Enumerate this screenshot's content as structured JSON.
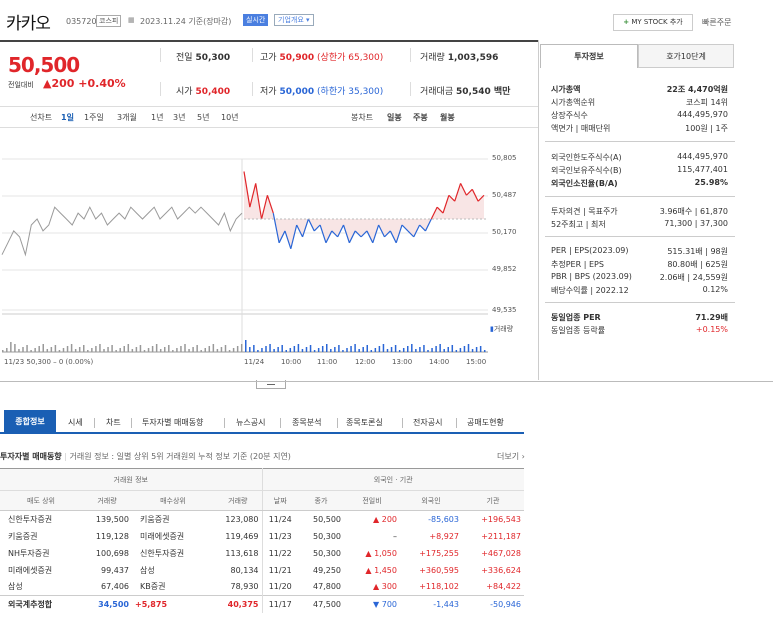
{
  "header": {
    "stock_name": "카카오",
    "stock_code": "035720",
    "market": "코스피",
    "date": "2023.11.24 기준(장마감)",
    "live_badge": "실시간",
    "company_info": "기업개요",
    "my_stock": "MY STOCK 추가",
    "quick_order": "빠른주문"
  },
  "price": {
    "current": "50,500",
    "change_label": "전일대비",
    "change": "▲200",
    "change_pct": "+0.40%"
  },
  "quote": {
    "prev_label": "전일",
    "prev": "50,300",
    "high_label": "고가",
    "high": "50,900",
    "high_limit": "(상한가 65,300)",
    "volume_label": "거래량",
    "volume": "1,003,596",
    "open_label": "시가",
    "open": "50,400",
    "low_label": "저가",
    "low": "50,000",
    "low_limit": "(하한가 35,300)",
    "amount_label": "거래대금",
    "amount": "50,540 백만"
  },
  "periods": {
    "items": [
      "선차트",
      "1일",
      "1주일",
      "3개월",
      "1년",
      "3년",
      "5년",
      "10년"
    ],
    "candle": [
      "봉차트",
      "일봉",
      "주봉",
      "월봉"
    ]
  },
  "chart_data": {
    "type": "line",
    "y_ticks": [
      "50,805",
      "50,487",
      "50,170",
      "49,852",
      "49,535"
    ],
    "ylim": [
      49535,
      50805
    ],
    "reference": 50300,
    "x_ticks": [
      "11/24",
      "10:00",
      "11:00",
      "12:00",
      "13:00",
      "14:00",
      "15:00"
    ],
    "prev_day_label": "11/23  50,300 – 0 (0.00%)",
    "volume_legend": "거래량",
    "series": [
      {
        "values": [
          50000,
          50100,
          50200,
          50150,
          50000,
          50250,
          50300,
          50200,
          50250,
          50400,
          50350,
          50300,
          50250,
          50350,
          50300,
          50400,
          50300,
          50350,
          50250,
          50300,
          50350,
          50300,
          50400,
          50350,
          50300,
          50350,
          50400,
          50300,
          50350,
          50400,
          50300,
          50350,
          50400,
          50350,
          50400,
          50350,
          50300,
          50250,
          50350,
          50200,
          50300,
          50350
        ]
      },
      {
        "values": [
          50700,
          50400,
          50600,
          50300,
          50500,
          50350,
          50100,
          50200,
          50050,
          50250,
          50150,
          50300,
          50200,
          50250,
          50100,
          50200,
          50150,
          50250,
          50100,
          50200,
          50150,
          50200,
          50100,
          50250,
          50150,
          50200,
          50100,
          50250,
          50200,
          50150,
          50250,
          50200,
          50300,
          50400,
          50350,
          50500,
          50450,
          50600,
          50500,
          50550,
          50450,
          50500
        ]
      }
    ]
  },
  "invest_tabs": [
    "투자정보",
    "호가10단계"
  ],
  "invest": [
    {
      "label": "시가총액",
      "value": "22조 4,470억원",
      "bold": true
    },
    {
      "label": "시가총액순위",
      "value": "코스피 14위"
    },
    {
      "label": "상장주식수",
      "value": "444,495,970"
    },
    {
      "label": "액면가 | 매매단위",
      "value": "100원 | 1주"
    },
    {
      "label": "외국인한도주식수(A)",
      "value": "444,495,970"
    },
    {
      "label": "외국인보유주식수(B)",
      "value": "115,477,401"
    },
    {
      "label": "외국인소진율(B/A)",
      "value": "25.98%",
      "bold": true
    },
    {
      "label": "투자의견 | 목표주가",
      "value": "3.96매수 | 61,870"
    },
    {
      "label": "52주최고 | 최저",
      "value": "71,300 | 37,300"
    },
    {
      "label": "PER | EPS(2023.09)",
      "value": "515.31배 | 98원"
    },
    {
      "label": "추정PER | EPS",
      "value": "80.80배 | 625원"
    },
    {
      "label": "PBR | BPS (2023.09)",
      "value": "2.06배 | 24,559원"
    },
    {
      "label": "배당수익률 | 2022.12",
      "value": "0.12%"
    },
    {
      "label": "동일업종 PER",
      "value": "71.29배",
      "bold": true
    },
    {
      "label": "동일업종 등락률",
      "value": "+0.15%"
    }
  ],
  "nav_tabs": [
    "종합정보",
    "시세",
    "차트",
    "투자자별 매매동향",
    "뉴스공시",
    "종목분석",
    "종목토론실",
    "전자공시",
    "공매도현황"
  ],
  "trade_section": {
    "title": "투자자별 매매동향",
    "desc": "거래원 정보 : 일별 상위 5위 거래원의 누적 정보 기준 (20분 지연)",
    "more": "더보기",
    "group1": "거래원 정보",
    "group2": "외국인 · 기관",
    "headers": [
      "매도 상위",
      "거래량",
      "매수상위",
      "거래량",
      "날짜",
      "종가",
      "전일비",
      "외국인",
      "기관"
    ]
  },
  "trade_rows": [
    {
      "sell": "신한투자증권",
      "sv": "139,500",
      "buy": "키움증권",
      "bv": "123,080",
      "date": "11/24",
      "close": "50,500",
      "diff": "▲ 200",
      "dir": "up",
      "foreign": "-85,603",
      "inst": "+196,543"
    },
    {
      "sell": "키움증권",
      "sv": "119,128",
      "buy": "미래에셋증권",
      "bv": "119,469",
      "date": "11/23",
      "close": "50,300",
      "diff": "–",
      "dir": "none",
      "foreign": "+8,927",
      "inst": "+211,187"
    },
    {
      "sell": "NH투자증권",
      "sv": "100,698",
      "buy": "신한투자증권",
      "bv": "113,618",
      "date": "11/22",
      "close": "50,300",
      "diff": "▲ 1,050",
      "dir": "up",
      "foreign": "+175,255",
      "inst": "+467,028"
    },
    {
      "sell": "미래에셋증권",
      "sv": "99,437",
      "buy": "삼성",
      "bv": "80,134",
      "date": "11/21",
      "close": "49,250",
      "diff": "▲ 1,450",
      "dir": "up",
      "foreign": "+360,595",
      "inst": "+336,624"
    },
    {
      "sell": "삼성",
      "sv": "67,406",
      "buy": "KB증권",
      "bv": "78,930",
      "date": "11/20",
      "close": "47,800",
      "diff": "▲ 300",
      "dir": "up",
      "foreign": "+118,102",
      "inst": "+84,422"
    }
  ],
  "trade_total": {
    "label": "외국계추정합",
    "sv": "34,500",
    "diff1": "+5,875",
    "bv": "40,375",
    "date": "11/17",
    "close": "47,500",
    "diff": "▼ 700",
    "foreign": "-1,443",
    "inst": "-50,946"
  }
}
